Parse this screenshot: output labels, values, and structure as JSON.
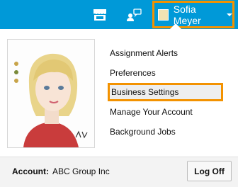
{
  "header": {
    "store_icon": "store-icon",
    "chat_icon": "chat-user-icon",
    "user_name": "Sofia Meyer",
    "user_avatar_icon": "user-avatar-icon",
    "caret_icon": "caret-down-icon",
    "colors": {
      "bar": "#0099d8",
      "highlight": "#f39200"
    }
  },
  "menu": {
    "items": [
      {
        "label": "Assignment Alerts"
      },
      {
        "label": "Preferences"
      },
      {
        "label": "Business Settings",
        "highlighted": true
      },
      {
        "label": "Manage Your Account"
      },
      {
        "label": "Background Jobs"
      }
    ]
  },
  "footer": {
    "account_label": "Account:",
    "account_value": "ABC Group Inc",
    "logoff_label": "Log Off"
  }
}
